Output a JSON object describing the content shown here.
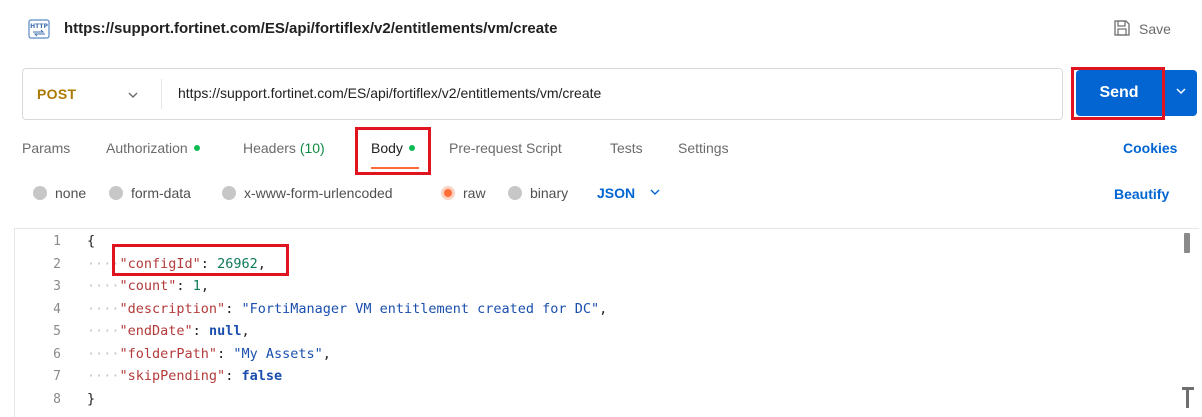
{
  "titlebar": {
    "title": "https://support.fortinet.com/ES/api/fortiflex/v2/entitlements/vm/create",
    "icon": "http-icon",
    "save_label": "Save"
  },
  "request": {
    "method": "POST",
    "url": "https://support.fortinet.com/ES/api/fortiflex/v2/entitlements/vm/create",
    "send_label": "Send"
  },
  "tabs": {
    "params": "Params",
    "authorization": "Authorization",
    "headers": "Headers",
    "headers_count": "(10)",
    "body": "Body",
    "prerequest": "Pre-request Script",
    "tests": "Tests",
    "settings": "Settings",
    "cookies": "Cookies"
  },
  "body_options": {
    "none": "none",
    "form_data": "form-data",
    "urlencoded": "x-www-form-urlencoded",
    "raw": "raw",
    "binary": "binary",
    "selected": "raw",
    "format": "JSON",
    "beautify": "Beautify"
  },
  "editor": {
    "line_numbers": [
      "1",
      "2",
      "3",
      "4",
      "5",
      "6",
      "7",
      "8"
    ],
    "lines": [
      {
        "indent": "",
        "key": "",
        "sep": "",
        "value": "",
        "open": "{"
      },
      {
        "indent": "····",
        "key": "\"configId\"",
        "sep": ": ",
        "value": "26962",
        "tail": ","
      },
      {
        "indent": "····",
        "key": "\"count\"",
        "sep": ": ",
        "value": "1",
        "tail": ","
      },
      {
        "indent": "····",
        "key": "\"description\"",
        "sep": ": ",
        "value": "\"FortiManager VM entitlement created for DC\"",
        "tail": ","
      },
      {
        "indent": "····",
        "key": "\"endDate\"",
        "sep": ": ",
        "value": "null",
        "tail": ","
      },
      {
        "indent": "····",
        "key": "\"folderPath\"",
        "sep": ": ",
        "value": "\"My Assets\"",
        "tail": ","
      },
      {
        "indent": "····",
        "key": "\"skipPending\"",
        "sep": ": ",
        "value": "false",
        "tail": ""
      },
      {
        "indent": "",
        "key": "",
        "sep": "",
        "value": "",
        "open": "}"
      }
    ]
  },
  "colors": {
    "accent_blue": "#0265d2",
    "method_post": "#ad7a03",
    "tab_underline": "#ff6c37",
    "status_dot": "#0cbb52",
    "highlight_box": "#e0141e"
  }
}
